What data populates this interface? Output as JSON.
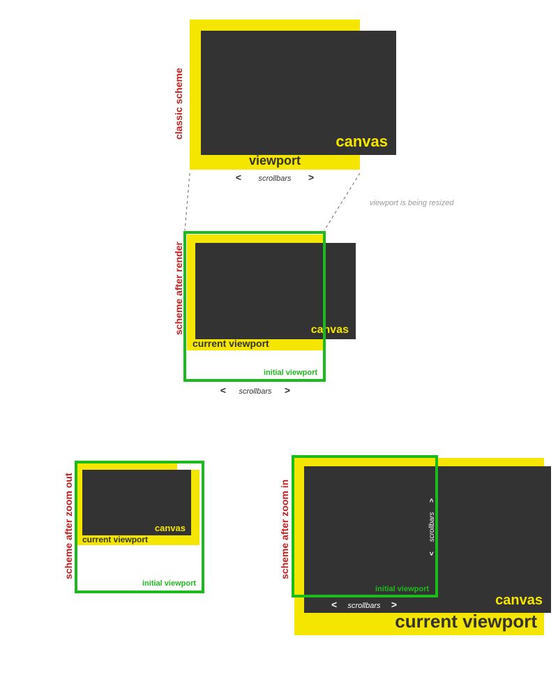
{
  "labels": {
    "classic": "classic scheme",
    "after_render": "scheme after render",
    "after_zoom_out": "scheme after zoom out",
    "after_zoom_in": "scheme after zoom in"
  },
  "words": {
    "canvas": "canvas",
    "viewport": "viewport",
    "current_viewport": "current viewport",
    "initial_viewport": "initial viewport",
    "scrollbars": "scrollbars",
    "resize_note": "viewport is being resized",
    "chev_left": "<",
    "chev_right": ">"
  }
}
